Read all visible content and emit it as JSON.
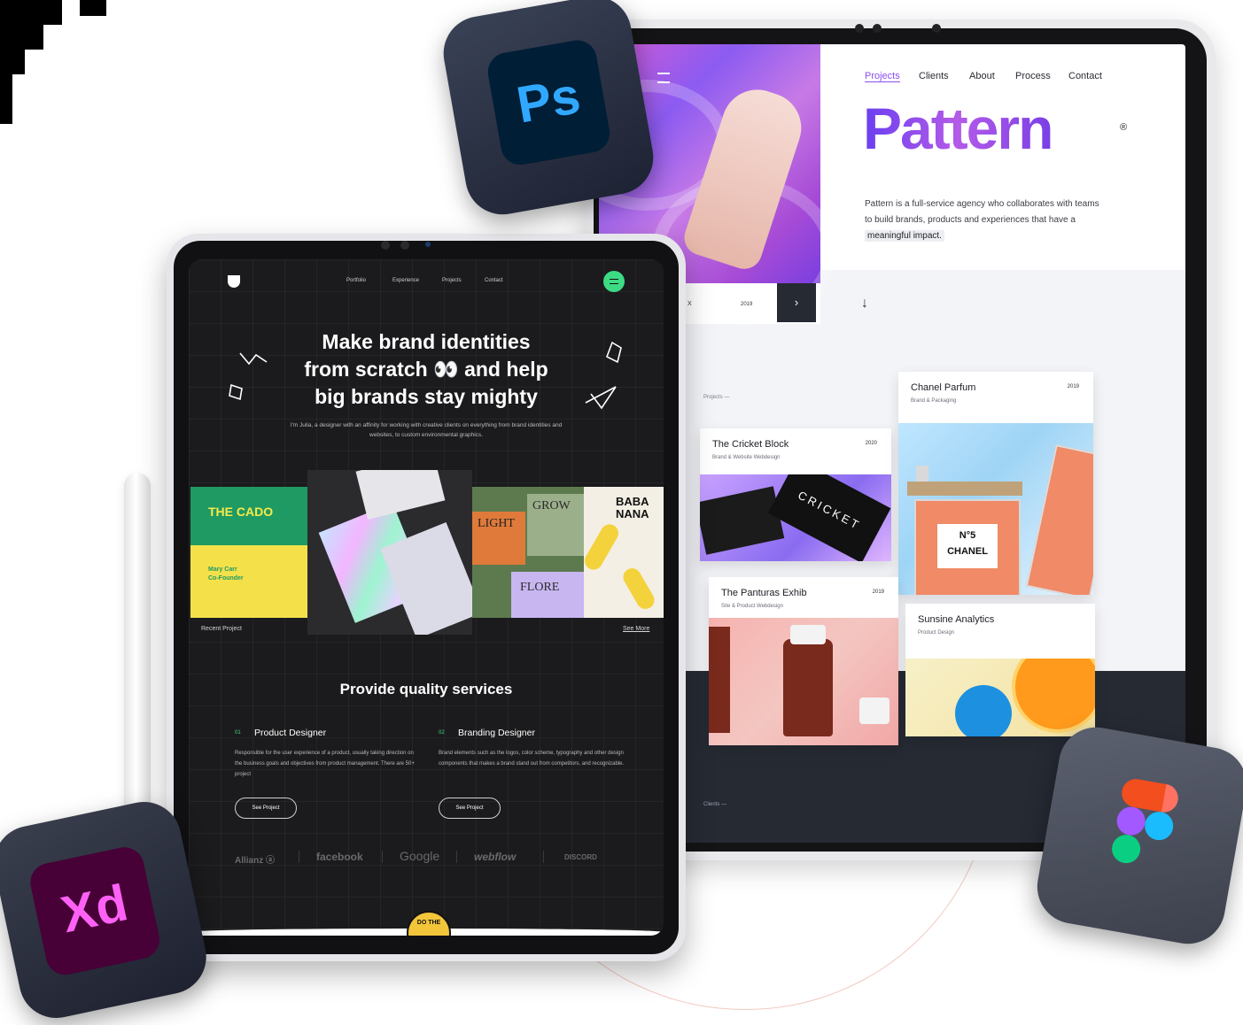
{
  "colors": {
    "accent_purple": "#8b4df0",
    "accent_green": "#3ddc84",
    "dark_bg": "#1b1b1d"
  },
  "back_site": {
    "nav": [
      "Projects",
      "Clients",
      "About",
      "Process",
      "Contact"
    ],
    "title": "Pattern",
    "registered": "®",
    "description_line1": "Pattern is a full-service agency who collaborates with teams",
    "description_line2": "to build brands, products and experiences that have a",
    "description_highlight": "meaningful impact.",
    "strip_left": "X",
    "strip_year": "2019",
    "next_arrow": "›",
    "down_arrow": "↓",
    "projects_label": "Projects —",
    "clients_label": "Clients —",
    "cards": [
      {
        "title": "The Cricket Block",
        "subtitle": "Brand & Website Webdesign",
        "year": "2020",
        "image_text": "CRICKET"
      },
      {
        "title": "Chanel Parfum",
        "subtitle": "Brand & Packaging",
        "year": "2019",
        "image_text_1": "N°5",
        "image_text_2": "CHANEL"
      },
      {
        "title": "The Panturas Exhib",
        "subtitle": "Site & Product Webdesign",
        "year": "2019"
      },
      {
        "title": "Sunsine Analytics",
        "subtitle": "Product Design",
        "year": ""
      }
    ]
  },
  "front_site": {
    "nav": [
      "Portfolio",
      "Experience",
      "Projects",
      "Contact"
    ],
    "headline_1": "Make brand identities",
    "headline_2": "from scratch 👀 and help",
    "headline_3": "big brands stay mighty",
    "intro": "I'm Julia, a designer with an affinity for working with creative clients on everything from brand identities and websites, to custom environmental graphics.",
    "tile_1_text": "THE CADO",
    "tile_1_name": "Mary Carr",
    "tile_1_role": "Co-Founder",
    "tile_3_text_1": "LIGHT",
    "tile_3_text_2": "GROW",
    "tile_3_text_3": "FLORE",
    "tile_4_text": "BABA NANA",
    "recent_label": "Recent Project",
    "see_more": "See More",
    "services_title": "Provide quality services",
    "services": [
      {
        "num": "01",
        "title": "Product Designer",
        "desc": "Responsible for the user experience of a product, usually taking direction on the business goals and objectives from product management. There are 50+ project",
        "button": "See Project"
      },
      {
        "num": "02",
        "title": "Branding Designer",
        "desc": "Brand elements such as the logos, color scheme, typography and other design components that makes a brand stand out from competitors, and recognizable.",
        "button": "See Project"
      }
    ],
    "brands": [
      "Allianz ⓐ",
      "facebook",
      "Google",
      "webflow",
      "DISCORD"
    ],
    "sticker_text": "DO THE"
  },
  "app_icons": {
    "ps": "Ps",
    "xd": "Xd"
  }
}
